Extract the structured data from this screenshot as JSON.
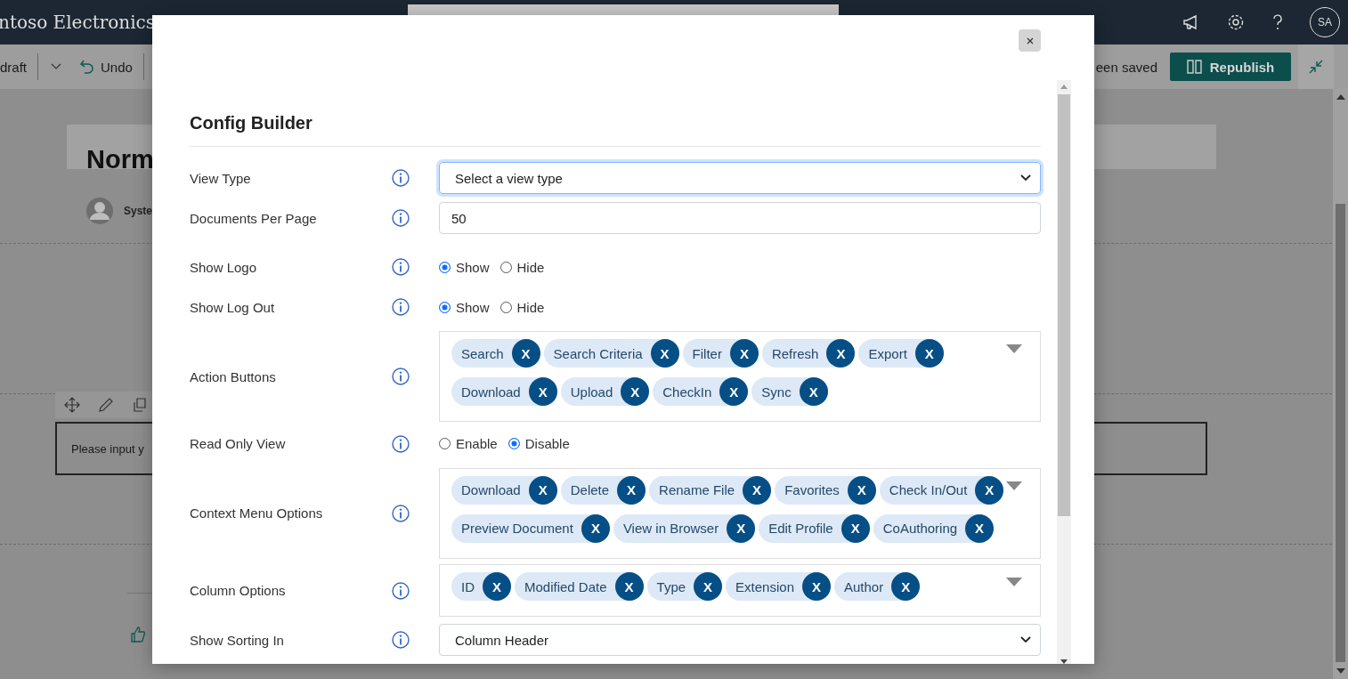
{
  "app_bar": {
    "site_title": "ntoso Electronics",
    "avatar_initials": "SA"
  },
  "command_bar": {
    "draft_label": "draft",
    "undo_label": "Undo",
    "save_status": "een saved",
    "republish_label": "Republish"
  },
  "page": {
    "title": "Norm",
    "author": "Syste",
    "text_box": "Please input y"
  },
  "dialog": {
    "title": "Config Builder",
    "fields": [
      {
        "kind": "select",
        "label": "View Type",
        "value": "Select a view type",
        "focused": true
      },
      {
        "kind": "text",
        "label": "Documents Per Page",
        "value": "50"
      },
      {
        "kind": "radio",
        "label": "Show Logo",
        "options": [
          {
            "label": "Show",
            "selected": true
          },
          {
            "label": "Hide",
            "selected": false
          }
        ]
      },
      {
        "kind": "radio",
        "label": "Show Log Out",
        "options": [
          {
            "label": "Show",
            "selected": true
          },
          {
            "label": "Hide",
            "selected": false
          }
        ]
      },
      {
        "kind": "tags",
        "label": "Action Buttons",
        "tags": [
          {
            "label": "Search",
            "remove": "X"
          },
          {
            "label": "Search Criteria",
            "remove": "X"
          },
          {
            "label": "Filter",
            "remove": "X"
          },
          {
            "label": "Refresh",
            "remove": "X"
          },
          {
            "label": "Export",
            "remove": "X"
          },
          {
            "label": "Download",
            "remove": "X"
          },
          {
            "label": "Upload",
            "remove": "X"
          },
          {
            "label": "CheckIn",
            "remove": "X"
          },
          {
            "label": "Sync",
            "remove": "X"
          }
        ]
      },
      {
        "kind": "radio",
        "label": "Read Only View",
        "options": [
          {
            "label": "Enable",
            "selected": false
          },
          {
            "label": "Disable",
            "selected": true
          }
        ]
      },
      {
        "kind": "tags",
        "label": "Context Menu Options",
        "tags": [
          {
            "label": "Download",
            "remove": "X"
          },
          {
            "label": "Delete",
            "remove": "X"
          },
          {
            "label": "Rename File",
            "remove": "X"
          },
          {
            "label": "Favorites",
            "remove": "X"
          },
          {
            "label": "Check In/Out",
            "remove": "X"
          },
          {
            "label": "Preview Document",
            "remove": "X"
          },
          {
            "label": "View in Browser",
            "remove": "X"
          },
          {
            "label": "Edit Profile",
            "remove": "X"
          },
          {
            "label": "CoAuthoring",
            "remove": "X"
          }
        ]
      },
      {
        "kind": "tags",
        "label": "Column Options",
        "tags": [
          {
            "label": "ID",
            "remove": "X"
          },
          {
            "label": "Modified Date",
            "remove": "X"
          },
          {
            "label": "Type",
            "remove": "X"
          },
          {
            "label": "Extension",
            "remove": "X"
          },
          {
            "label": "Author",
            "remove": "X"
          }
        ]
      },
      {
        "kind": "select",
        "label": "Show Sorting In",
        "value": "Column Header",
        "focused": false
      }
    ]
  }
}
